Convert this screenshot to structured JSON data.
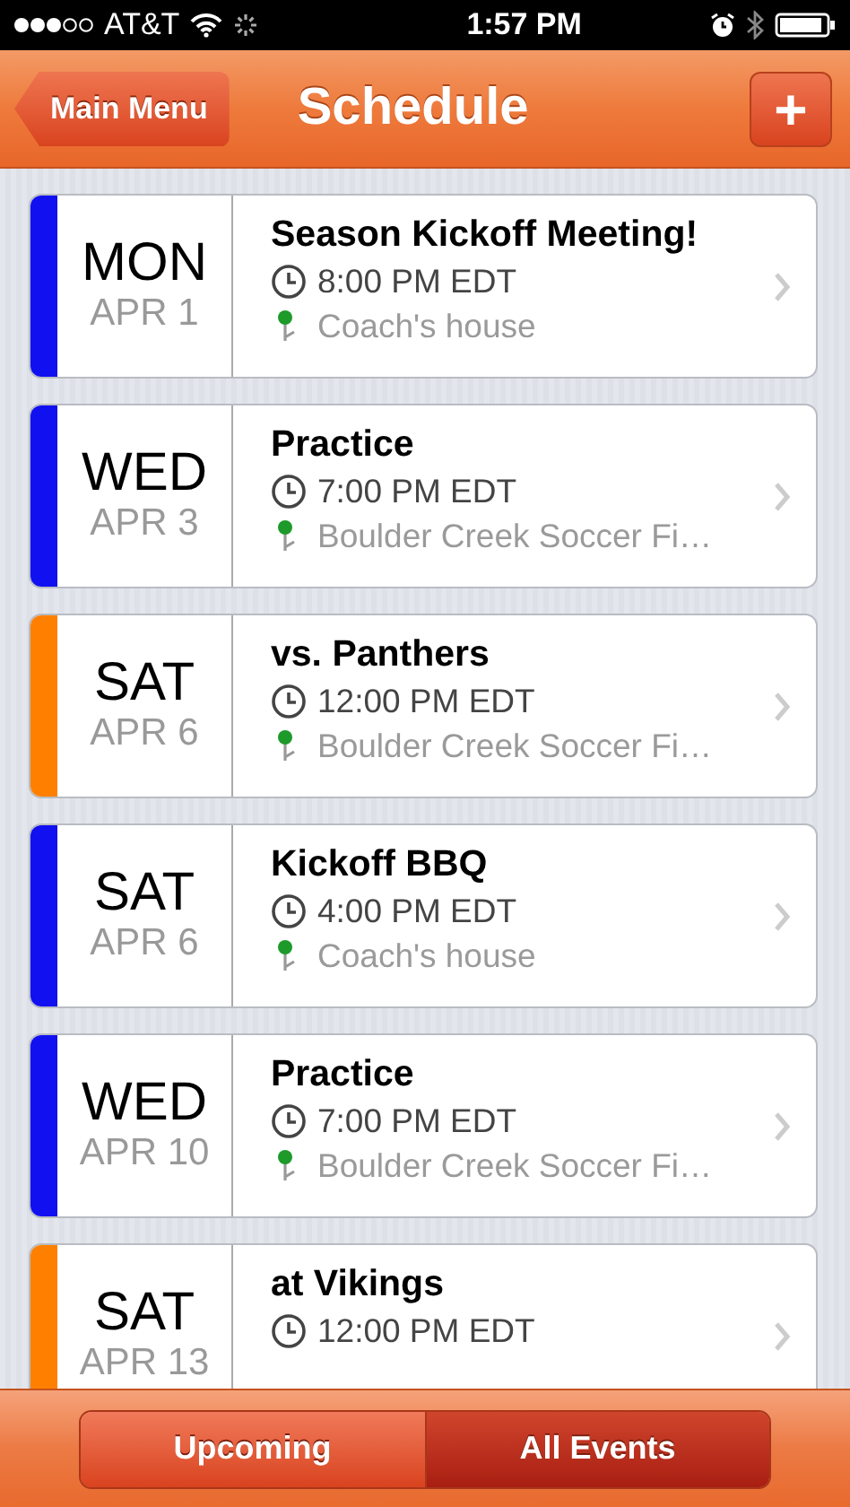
{
  "status_bar": {
    "carrier": "AT&T",
    "time": "1:57 PM"
  },
  "header": {
    "back_button": "Main Menu",
    "title": "Schedule",
    "add_button": "+"
  },
  "events": [
    {
      "day": "MON",
      "date": "APR 1",
      "title": "Season Kickoff Meeting!",
      "time": "8:00 PM EDT",
      "location": "Coach's house",
      "color": "#1010f0"
    },
    {
      "day": "WED",
      "date": "APR 3",
      "title": "Practice",
      "time": "7:00 PM EDT",
      "location": "Boulder Creek Soccer Fi…",
      "color": "#1010f0"
    },
    {
      "day": "SAT",
      "date": "APR 6",
      "title": "vs. Panthers",
      "time": "12:00 PM EDT",
      "location": "Boulder Creek Soccer Fi…",
      "color": "#ff8000"
    },
    {
      "day": "SAT",
      "date": "APR 6",
      "title": "Kickoff BBQ",
      "time": "4:00 PM EDT",
      "location": "Coach's house",
      "color": "#1010f0"
    },
    {
      "day": "WED",
      "date": "APR 10",
      "title": "Practice",
      "time": "7:00 PM EDT",
      "location": "Boulder Creek Soccer Fi…",
      "color": "#1010f0"
    },
    {
      "day": "SAT",
      "date": "APR 13",
      "title": "at Vikings",
      "time": "12:00 PM EDT",
      "color": "#ff8000"
    }
  ],
  "tabs": [
    {
      "label": "Upcoming",
      "selected": false
    },
    {
      "label": "All Events",
      "selected": true
    }
  ]
}
